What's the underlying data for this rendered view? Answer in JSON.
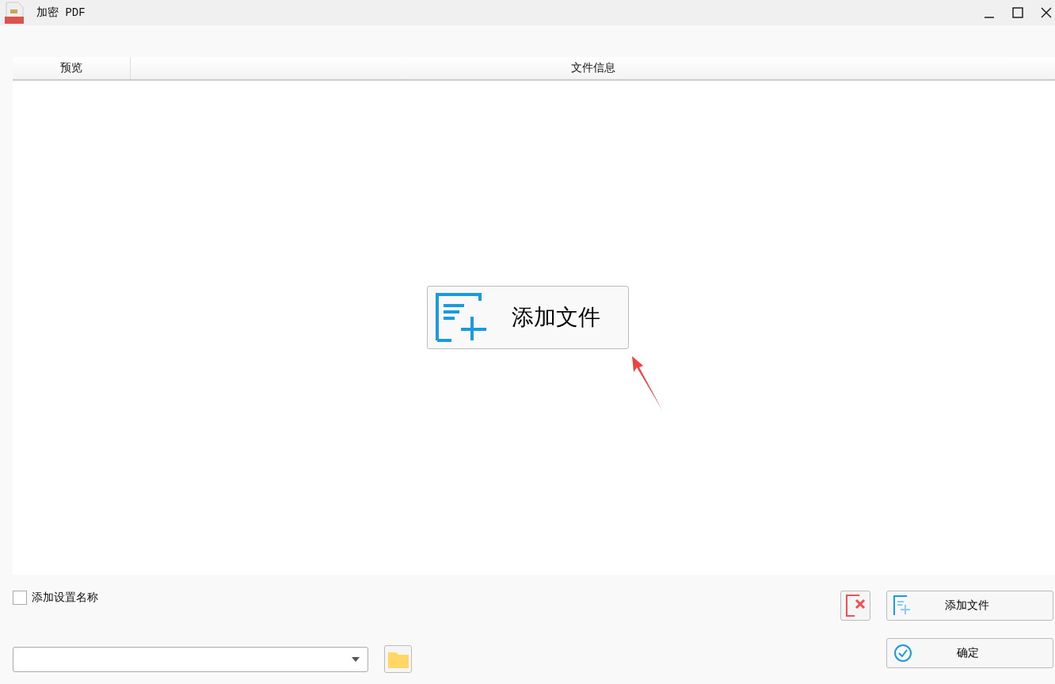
{
  "window": {
    "title": "加密 PDF"
  },
  "table": {
    "columns": [
      "预览",
      "文件信息"
    ]
  },
  "center_button": {
    "label": "添加文件"
  },
  "options": {
    "label": "添加设置名称",
    "checked": false
  },
  "buttons": [
    {
      "kind": "add",
      "label": "添加文件"
    },
    {
      "kind": "confirm",
      "label": "确定"
    }
  ]
}
